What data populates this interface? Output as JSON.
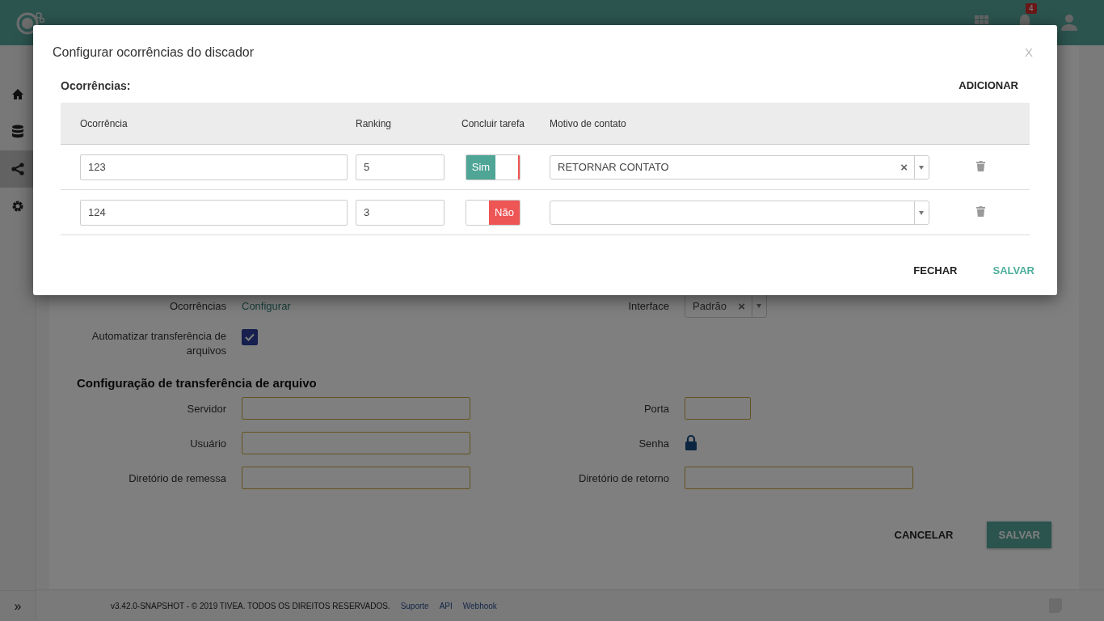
{
  "header": {
    "notifications": "4"
  },
  "sidebar": {
    "items": [
      {
        "kind": "home",
        "selected": false
      },
      {
        "kind": "database",
        "selected": false
      },
      {
        "kind": "share",
        "selected": true
      },
      {
        "kind": "settings",
        "selected": false
      }
    ],
    "expand": "»"
  },
  "form": {
    "occurrences_label": "Ocorrências",
    "occurrences_link": "Configurar",
    "interface_label": "Interface",
    "interface_value": "Padrão",
    "interface_clear": "×",
    "auto_transfer_label": "Automatizar transferência de arquivos",
    "auto_transfer": {
      "checked": true
    },
    "section_title": "Configuração de transferência de arquivo",
    "fields": [
      {
        "label": "Servidor",
        "kind": "text"
      },
      {
        "label": "Porta",
        "kind": "short"
      },
      {
        "label": "Usuário",
        "kind": "text"
      },
      {
        "label": "Senha",
        "kind": "lock"
      },
      {
        "label": "Diretório de remessa",
        "kind": "text"
      },
      {
        "label": "Diretório de retorno",
        "kind": "text"
      }
    ],
    "buttons": [
      "CANCELAR",
      "SALVAR"
    ]
  },
  "footer": {
    "text": "v3.42.0-SNAPSHOT - © 2019 TIVEA. TODOS OS DIREITOS RESERVADOS.",
    "links": [
      "Suporte",
      "API",
      "Webhook"
    ]
  },
  "modal": {
    "title": "Configurar ocorrências do discador",
    "close": "X",
    "section": "Ocorrências:",
    "add": "ADICIONAR",
    "columns": [
      "Ocorrência",
      "Ranking",
      "Concluir tarefa",
      "Motivo de contato"
    ],
    "rows": [
      {
        "occurrence": "123",
        "ranking": "5",
        "toggle": {
          "on": true,
          "label": "Sim"
        },
        "reason": "RETORNAR CONTATO",
        "clear": "×"
      },
      {
        "occurrence": "124",
        "ranking": "3",
        "toggle": {
          "on": false,
          "label": "Não"
        }
      }
    ],
    "buttons": [
      "FECHAR",
      "SALVAR"
    ]
  }
}
